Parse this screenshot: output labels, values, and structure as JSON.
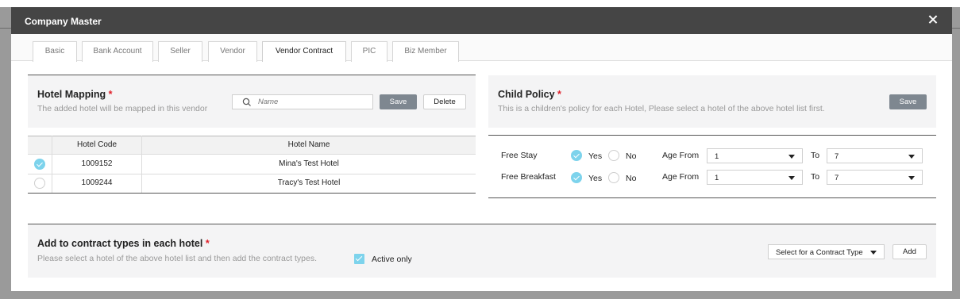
{
  "modal": {
    "title": "Company Master"
  },
  "tabs": [
    {
      "label": "Basic"
    },
    {
      "label": "Bank Account"
    },
    {
      "label": "Seller"
    },
    {
      "label": "Vendor"
    },
    {
      "label": "Vendor Contract"
    },
    {
      "label": "PIC"
    },
    {
      "label": "Biz Member"
    }
  ],
  "active_tab": "Vendor Contract",
  "hotel_mapping": {
    "title": "Hotel Mapping",
    "required_mark": "*",
    "description": "The added hotel will be mapped in this vendor",
    "search_placeholder": "Name",
    "save_label": "Save",
    "delete_label": "Delete",
    "columns": [
      "Hotel Code",
      "Hotel Name"
    ],
    "rows": [
      {
        "code": "1009152",
        "name": "Mina's Test Hotel",
        "selected": true
      },
      {
        "code": "1009244",
        "name": "Tracy's Test Hotel",
        "selected": false
      }
    ]
  },
  "child_policy": {
    "title": "Child Policy",
    "required_mark": "*",
    "description": "This is a children's policy for each Hotel, Please select a hotel of the above hotel list first.",
    "save_label": "Save",
    "rows": [
      {
        "label": "Free Stay",
        "yes": "Yes",
        "no": "No",
        "age_from_label": "Age From",
        "age_from": "1",
        "to_label": "To",
        "to": "7"
      },
      {
        "label": "Free Breakfast",
        "yes": "Yes",
        "no": "No",
        "age_from_label": "Age From",
        "age_from": "1",
        "to_label": "To",
        "to": "7"
      }
    ]
  },
  "contract_types": {
    "title": "Add to contract types in each hotel",
    "required_mark": "*",
    "description": "Please select a hotel of the above hotel list and then add the contract types.",
    "active_only_label": "Active only",
    "select_label": "Select for a Contract Type",
    "add_label": "Add"
  },
  "colors": {
    "header_bg": "#454545",
    "accent": "#7dd3ec",
    "required": "#e0202a",
    "button_gray": "#7e8790"
  }
}
